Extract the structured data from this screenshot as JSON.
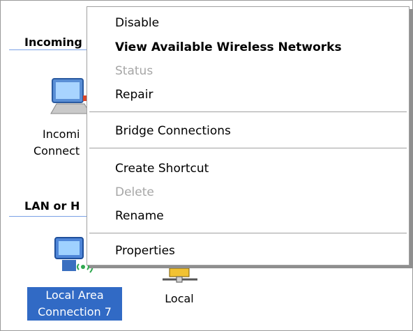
{
  "folder": {
    "groups": [
      {
        "title": "Incoming"
      },
      {
        "title": "LAN or H"
      }
    ],
    "items": [
      {
        "label_line1": "Incomi",
        "label_line2": "Connect"
      },
      {
        "label_line1": "Local Area",
        "label_line2": "Connection 7"
      },
      {
        "label_line1": "Local"
      }
    ]
  },
  "context_menu": {
    "items": [
      {
        "label": "Disable"
      },
      {
        "label": "View Available Wireless Networks"
      },
      {
        "label": "Status"
      },
      {
        "label": "Repair"
      },
      {
        "label": "Bridge Connections"
      },
      {
        "label": "Create Shortcut"
      },
      {
        "label": "Delete"
      },
      {
        "label": "Rename"
      },
      {
        "label": "Properties"
      }
    ]
  }
}
